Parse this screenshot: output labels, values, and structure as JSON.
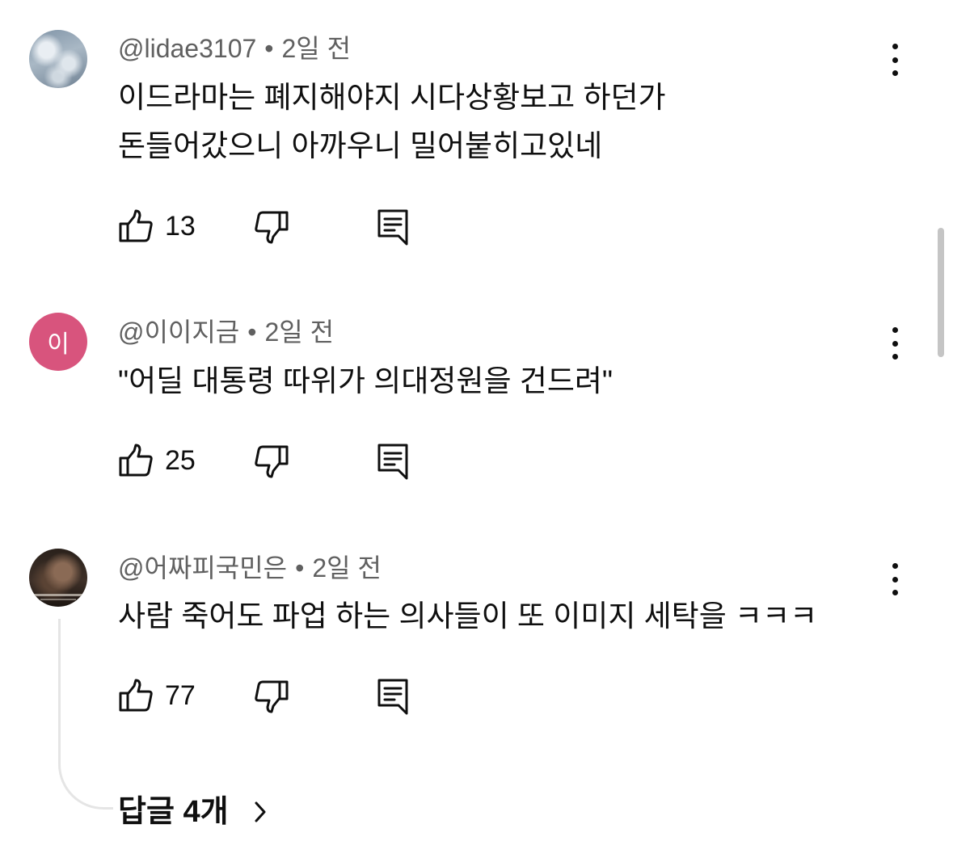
{
  "comments": [
    {
      "author": "@lidae3107",
      "time": "2일 전",
      "lines": [
        "이드라마는 폐지해야지 시다상황보고 하던가",
        "돈들어갔으니 아까우니 밀어붙히고있네"
      ],
      "likes": "13",
      "avatar_letter": ""
    },
    {
      "author": "@이이지금",
      "time": "2일 전",
      "lines": [
        "\"어딜 대통령 따위가 의대정원을 건드려\""
      ],
      "likes": "25",
      "avatar_letter": "이"
    },
    {
      "author": "@어짜피국민은",
      "time": "2일 전",
      "lines": [
        "사람 죽어도 파업 하는 의사들이 또 이미지 세탁을 ㅋㅋㅋ"
      ],
      "likes": "77",
      "avatar_letter": ""
    }
  ],
  "replies_label": "답글 4개",
  "meta_separator": "•",
  "icons": {
    "like": "thumbs-up-icon",
    "dislike": "thumbs-down-icon",
    "reply": "reply-comment-icon",
    "more": "more-vertical-icon",
    "expand": "chevron-right-icon"
  },
  "colors": {
    "text": "#0f0f0f",
    "meta": "#606060",
    "avatar_letter_bg": "#d8547d",
    "thread_line": "#e5e5e5"
  }
}
